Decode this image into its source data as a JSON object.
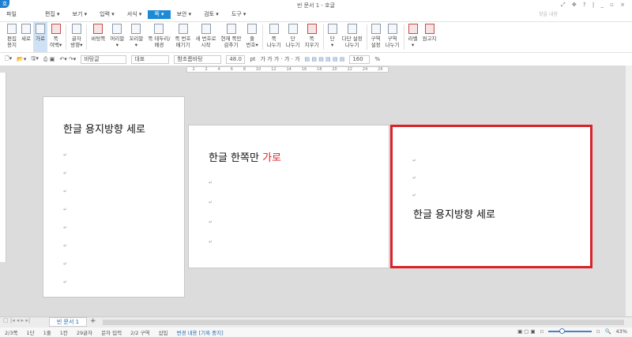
{
  "app": {
    "title": "빈 문서 1 - 호글",
    "logo": "호",
    "window_controls": "⤢ ✥ ? | _ ▫ ×"
  },
  "menu": [
    {
      "label": "파일"
    },
    {
      "label": "편집 ▾"
    },
    {
      "label": "보기 ▾"
    },
    {
      "label": "입력 ▾"
    },
    {
      "label": "서식 ▾"
    },
    {
      "label": "쪽 ▾"
    },
    {
      "label": "보안 ▾"
    },
    {
      "label": "검토 ▾"
    },
    {
      "label": "도구 ▾"
    }
  ],
  "search_placeholder": "찾을 내용",
  "ribbon": [
    {
      "label": "편집\n용지"
    },
    {
      "label": "세로"
    },
    {
      "label": "가로"
    },
    {
      "label": "쪽\n여백▾"
    },
    {
      "label": "글자\n방향▾"
    },
    {
      "label": "바탕쪽"
    },
    {
      "label": "머리말\n▾"
    },
    {
      "label": "꼬리말\n▾"
    },
    {
      "label": "쪽 테두리/\n배경"
    },
    {
      "label": "쪽 번호\n매기기"
    },
    {
      "label": "새 번호로\n시작"
    },
    {
      "label": "현재 쪽만\n감추기"
    },
    {
      "label": "줄\n번호▾"
    },
    {
      "label": "쪽\n나누기"
    },
    {
      "label": "단\n나누기"
    },
    {
      "label": "쪽\n지우기"
    },
    {
      "label": "단\n▾"
    },
    {
      "label": "다단 설정\n나누기"
    },
    {
      "label": "구역\n설정"
    },
    {
      "label": "구역\n나누기"
    },
    {
      "label": "라벨\n▾"
    },
    {
      "label": "원고지"
    }
  ],
  "toolbar": {
    "style": "바탕글",
    "lang": "대표",
    "font": "함초롬바탕",
    "size": "48.0",
    "unit": "pt",
    "line_spacing": "160",
    "pct": "%",
    "fmt": "가 가 가 · 가 · 가"
  },
  "ruler": [
    "2",
    "2",
    "4",
    "6",
    "8",
    "10",
    "12",
    "14",
    "16",
    "18",
    "20",
    "22",
    "24",
    "26"
  ],
  "pages": [
    {
      "text": "한글 용지방향 세로"
    },
    {
      "text": "한글 한쪽만 ",
      "highlight": "가로",
      "highlight_color": "#d9222a"
    },
    {
      "text": "한글 용지방향 세로"
    }
  ],
  "tabs": {
    "doc": "빈 문서 1",
    "add": "+"
  },
  "status": [
    "2/3쪽",
    "1단",
    "1줄",
    "1칸",
    "29글자",
    "문자 입력",
    "2/2 구역",
    "삽입"
  ],
  "status_track": "변경 내용 [기록 중지]",
  "zoom": "43%"
}
